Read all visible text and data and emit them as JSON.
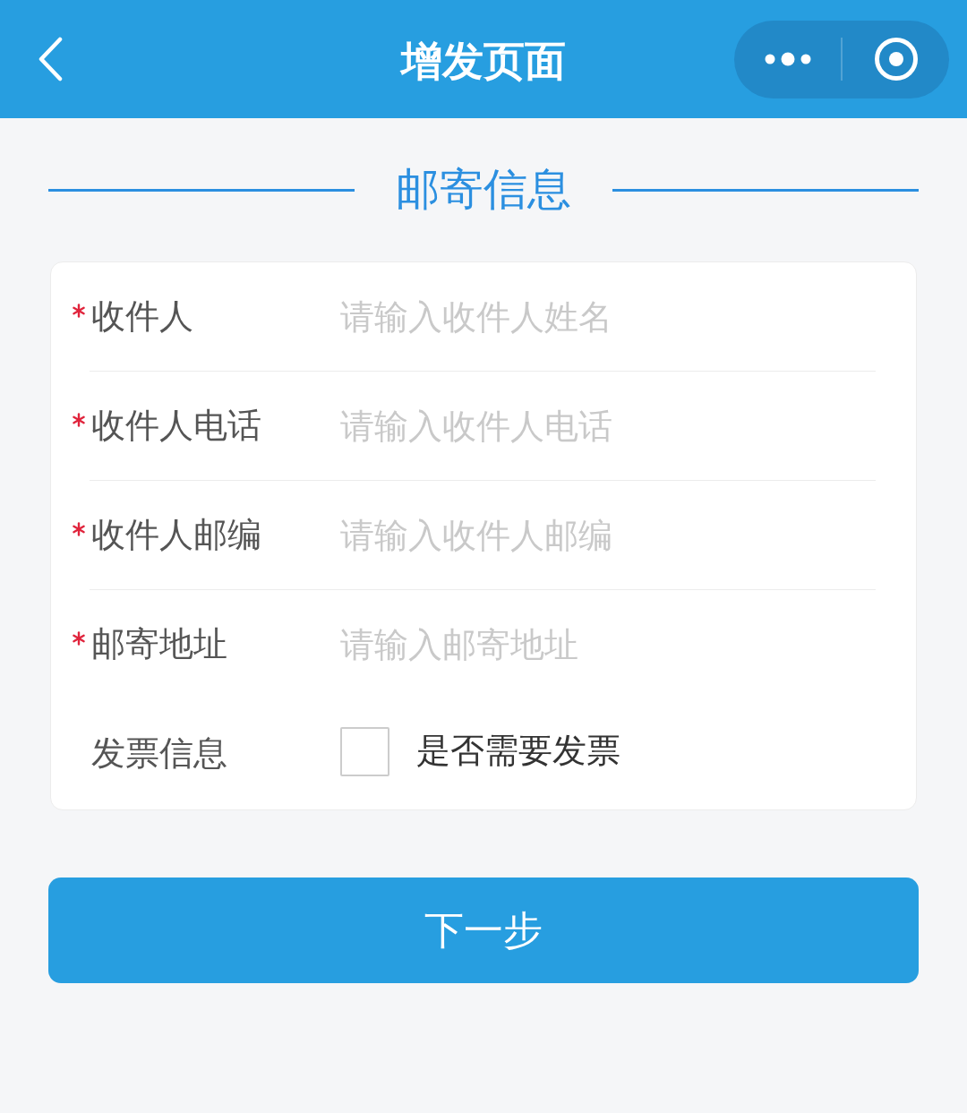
{
  "nav_bar": {
    "title": "增发页面"
  },
  "section": {
    "title": "邮寄信息"
  },
  "form": {
    "fields": [
      {
        "kind": "input",
        "required": true,
        "label": "收件人",
        "placeholder": "请输入收件人姓名"
      },
      {
        "kind": "input",
        "required": true,
        "label": "收件人电话",
        "placeholder": "请输入收件人电话"
      },
      {
        "kind": "input",
        "required": true,
        "label": "收件人邮编",
        "placeholder": "请输入收件人邮编"
      },
      {
        "kind": "input",
        "required": true,
        "label": "邮寄地址",
        "placeholder": "请输入邮寄地址"
      },
      {
        "kind": "checkbox",
        "required": false,
        "label": "发票信息",
        "checked": false,
        "option": "是否需要发票"
      }
    ]
  },
  "next_button": {
    "label": "下一步"
  }
}
